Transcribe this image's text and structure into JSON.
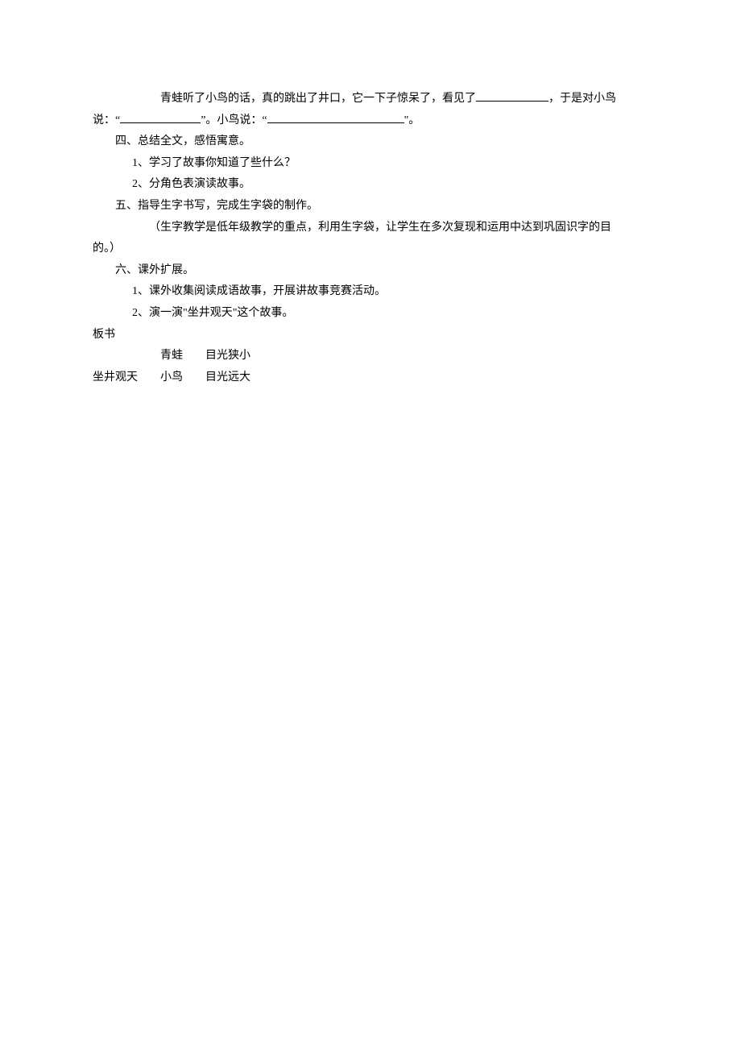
{
  "paragraph1": {
    "part1": "青蛙听了小鸟的话，真的跳出了井口，它一下子惊呆了，看见了",
    "part2": "，于是对小鸟说：\"",
    "part3": "\"。小鸟说：\"",
    "part4": "\"。"
  },
  "section4": {
    "title": "四、总结全文，感悟寓意。",
    "item1": "1、学习了故事你知道了些什么？",
    "item2": "2、分角色表演读故事。"
  },
  "section5": {
    "title": "五、指导生字书写，完成生字袋的制作。",
    "note_part1": "（生字教学是低年级教学的重点，利用生字袋，让学生在多次复现和运用中达到巩固识字的目",
    "note_part2": "的。）"
  },
  "section6": {
    "title": "六、课外扩展。",
    "item1": "1、课外收集阅读成语故事，开展讲故事竞赛活动。",
    "item2": "2、演一演\"坐井观天\"这个故事。"
  },
  "board": {
    "title": "板书",
    "row1_animal": "青蛙",
    "row1_desc": "目光狭小",
    "row2_label": "坐井观天",
    "row2_animal": "小鸟",
    "row2_desc": "目光远大"
  }
}
